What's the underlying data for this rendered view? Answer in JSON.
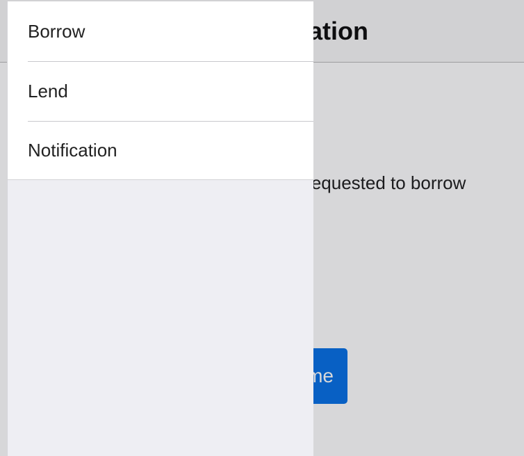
{
  "page": {
    "title": "Notification",
    "message": "Your friend has requested to borrow",
    "button_label": "Welcome"
  },
  "side_menu": {
    "items": [
      {
        "label": "Borrow"
      },
      {
        "label": "Lend"
      },
      {
        "label": "Notification"
      }
    ]
  },
  "colors": {
    "button": "#0a72e6",
    "menu_background": "#ffffff",
    "menu_pane": "#eeeef3",
    "header_background": "#f8f8f8"
  }
}
